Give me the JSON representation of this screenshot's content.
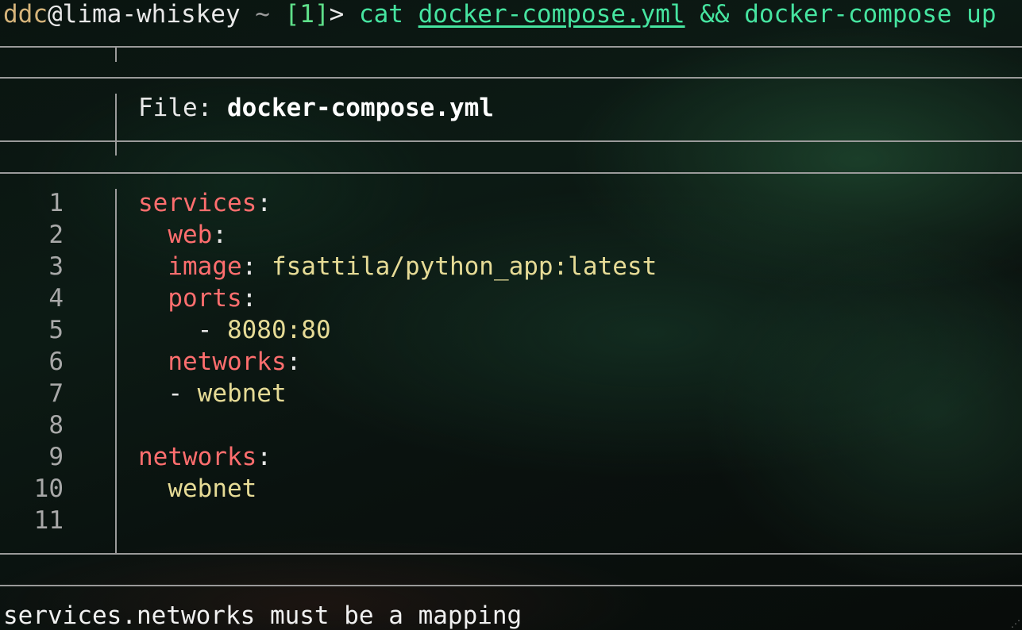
{
  "prompt": {
    "user": "ddc",
    "at": "@",
    "host": "lima-whiskey",
    "cwd": " ~ ",
    "job": "[1]",
    "arrow": "> ",
    "cmd1": "cat ",
    "file_arg": "docker-compose.yml",
    "rest": " && docker-compose up"
  },
  "viewer": {
    "file_label": "File: ",
    "file_name": "docker-compose.yml",
    "lines": [
      {
        "no": "1",
        "indent": "",
        "key": "services",
        "punct": ":",
        "value": ""
      },
      {
        "no": "2",
        "indent": "  ",
        "key": "web",
        "punct": ":",
        "value": ""
      },
      {
        "no": "3",
        "indent": "  ",
        "key": "image",
        "punct": ": ",
        "value": "fsattila/python_app:latest"
      },
      {
        "no": "4",
        "indent": "  ",
        "key": "ports",
        "punct": ":",
        "value": ""
      },
      {
        "no": "5",
        "indent": "    ",
        "key": "",
        "punct": "- ",
        "value": "8080:80"
      },
      {
        "no": "6",
        "indent": "  ",
        "key": "networks",
        "punct": ":",
        "value": ""
      },
      {
        "no": "7",
        "indent": "  ",
        "key": "",
        "punct": "- ",
        "value": "webnet"
      },
      {
        "no": "8",
        "indent": "",
        "key": "",
        "punct": "",
        "value": ""
      },
      {
        "no": "9",
        "indent": "",
        "key": "networks",
        "punct": ":",
        "value": ""
      },
      {
        "no": "10",
        "indent": "  ",
        "key": "",
        "punct": "",
        "value": "webnet"
      },
      {
        "no": "11",
        "indent": "",
        "key": "",
        "punct": "",
        "value": ""
      }
    ]
  },
  "error_message": "services.networks must be a mapping"
}
